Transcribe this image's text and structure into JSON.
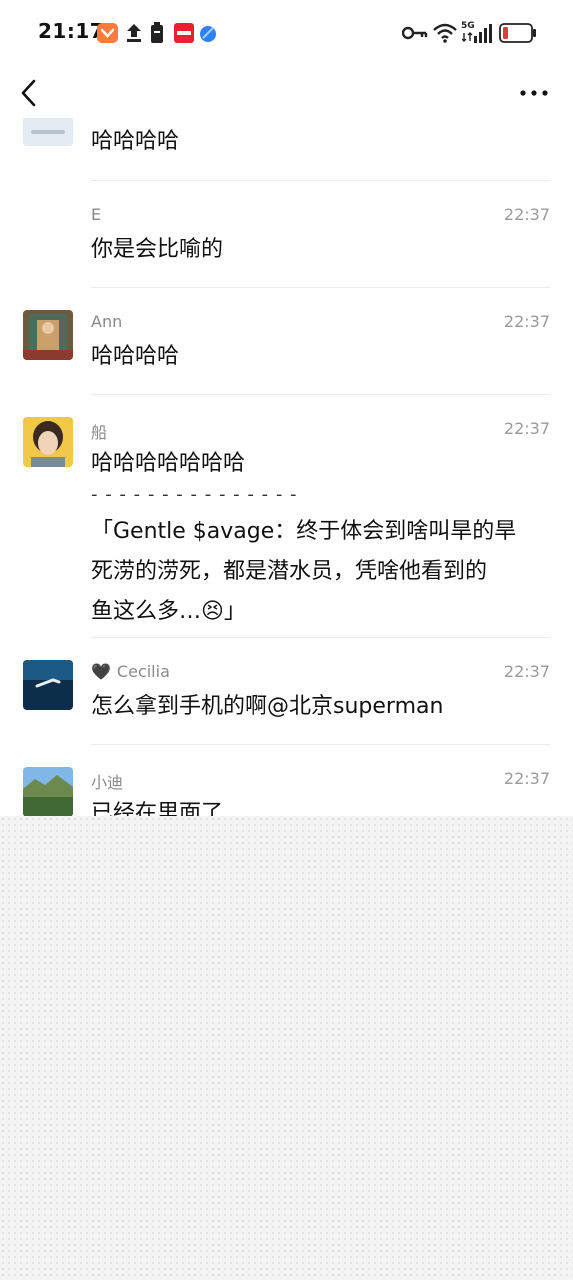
{
  "status_bar": {
    "time": "21:17",
    "network": "5G",
    "left_icons": [
      "app-notification-icon",
      "upload-icon",
      "battery-saver-icon",
      "app-red-icon",
      "app-blue-icon"
    ],
    "right_icons": [
      "key-icon",
      "wifi-icon",
      "signal-icon",
      "battery-icon"
    ]
  },
  "nav": {
    "back_icon": "chevron-left-icon",
    "more_icon": "more-dots-icon"
  },
  "messages": [
    {
      "name": "",
      "time": "",
      "text": "哈哈哈哈"
    },
    {
      "name": "E",
      "time": "22:37",
      "text": "你是会比喻的"
    },
    {
      "name": "Ann",
      "time": "22:37",
      "text": "哈哈哈哈"
    },
    {
      "name": "船",
      "time": "22:37",
      "text": "哈哈哈哈哈哈哈",
      "separator": "- - - - - - - - - - - - - - -",
      "quote_lines": [
        "「Gentle $avage：终于体会到啥叫旱的旱",
        "死涝的涝死，都是潜水员，凭啥他看到的",
        "鱼这么多…😣」"
      ]
    },
    {
      "name": "Cecilia",
      "name_prefix_icon": "black-heart-icon",
      "time": "22:37",
      "text": "怎么拿到手机的啊@北京superman"
    },
    {
      "name": "小迪",
      "time": "22:37",
      "text": "已经在里面了"
    }
  ],
  "colors": {
    "background": "#ffffff",
    "name_text": "#8a8a8a",
    "timestamp_text": "#9a9a9a",
    "battery_low": "#e23b3b",
    "bottom_pattern": "#f4f4f4"
  }
}
